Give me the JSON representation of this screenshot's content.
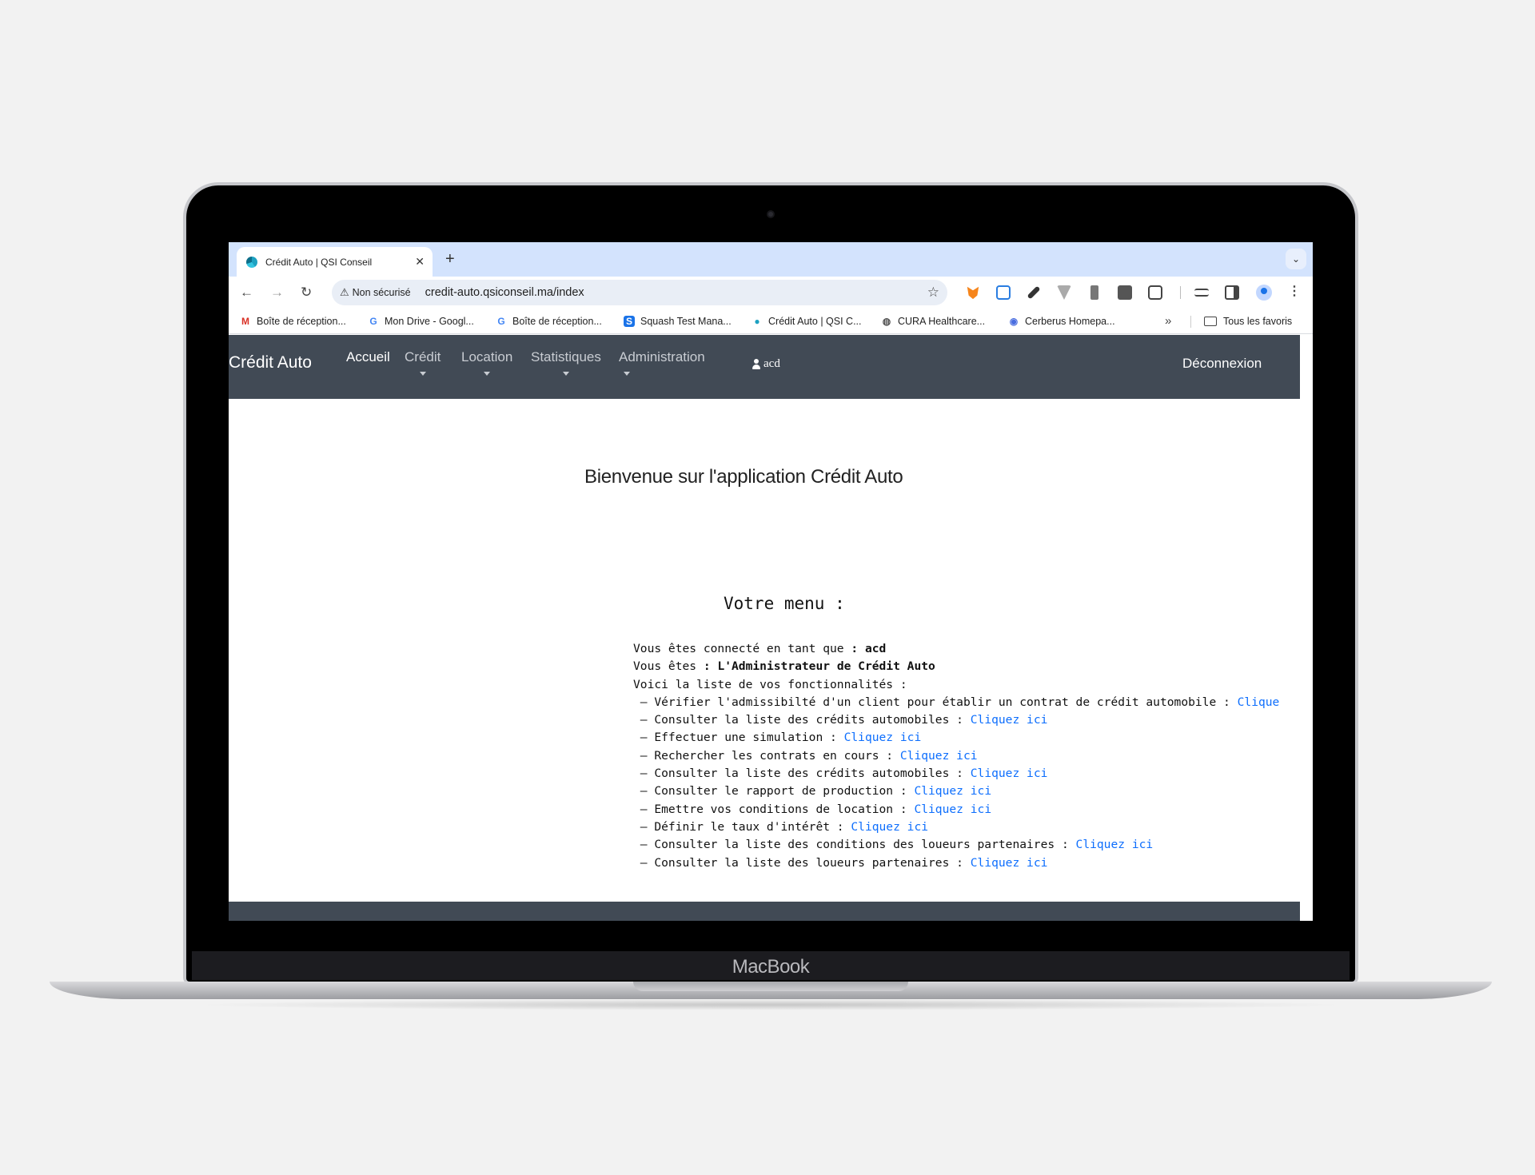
{
  "device": {
    "label": "MacBook"
  },
  "browser": {
    "tab": {
      "title": "Crédit Auto | QSI Conseil",
      "close": "✕",
      "new_tab": "+"
    },
    "tab_dropdown": "⌄",
    "nav": {
      "back": "←",
      "forward": "→",
      "reload": "↻"
    },
    "omnibox": {
      "security_icon": "⚠",
      "security_label": "Non sécurisé",
      "url": "credit-auto.qsiconseil.ma/index",
      "star": "☆"
    },
    "extensions": [
      "metamask-icon",
      "sync-icon",
      "eyedropper-icon",
      "vue-icon",
      "panel-icon",
      "selenium-icon",
      "puzzle-icon",
      "media-icon",
      "sidepanel-icon"
    ],
    "kebab": "⋮",
    "bookmarks": [
      {
        "icon": "M",
        "color": "#d93025",
        "label": "Boîte de réception..."
      },
      {
        "icon": "G",
        "color": "#4285f4",
        "label": "Mon Drive - Googl..."
      },
      {
        "icon": "G",
        "color": "#4285f4",
        "label": "Boîte de réception..."
      },
      {
        "icon": "S",
        "color": "#1a73e8",
        "label": "Squash Test Mana..."
      },
      {
        "icon": "●",
        "color": "#1da1c1",
        "label": "Crédit Auto | QSI C..."
      },
      {
        "icon": "◍",
        "color": "#555555",
        "label": "CURA Healthcare..."
      },
      {
        "icon": "◉",
        "color": "#4a6ee0",
        "label": "Cerberus Homepa..."
      }
    ],
    "bookmarks_more": "»",
    "all_bookmarks": "Tous les favoris"
  },
  "app": {
    "brand": "Crédit Auto",
    "nav": [
      "Accueil",
      "Crédit",
      "Location",
      "Statistiques",
      "Administration"
    ],
    "user": "acd",
    "logout": "Déconnexion",
    "welcome": "Bienvenue sur l'application Crédit Auto",
    "menu_title": "Votre menu :",
    "connected_prefix": "Vous êtes connecté en tant que ",
    "connected_sep": ": ",
    "connected_user": "acd",
    "role_prefix": "Vous êtes ",
    "role_sep": ": ",
    "role": "L'Administrateur de Crédit Auto",
    "features_intro": "Voici la liste de vos fonctionnalités :",
    "link_label": "Cliquez ici",
    "features": [
      {
        "text": " – Vérifier l'admissibilté d'un client pour établir un contrat de crédit automobile : ",
        "link": "Clique"
      },
      {
        "text": " – Consulter la liste des crédits automobiles : ",
        "link": "Cliquez ici"
      },
      {
        "text": " – Effectuer une simulation : ",
        "link": "Cliquez ici"
      },
      {
        "text": " – Rechercher les contrats en cours : ",
        "link": "Cliquez ici"
      },
      {
        "text": " – Consulter la liste des crédits automobiles : ",
        "link": "Cliquez ici"
      },
      {
        "text": " – Consulter le rapport de production : ",
        "link": "Cliquez ici"
      },
      {
        "text": " – Emettre vos conditions de location : ",
        "link": "Cliquez ici"
      },
      {
        "text": " – Définir le taux d'intérêt : ",
        "link": "Cliquez ici"
      },
      {
        "text": " – Consulter la liste des conditions des loueurs partenaires : ",
        "link": "Cliquez ici"
      },
      {
        "text": " – Consulter la liste des loueurs partenaires : ",
        "link": "Cliquez ici"
      }
    ]
  },
  "colors": {
    "navbar": "#414a55",
    "link": "#0d6efd",
    "tabstrip": "#d3e3fd"
  }
}
